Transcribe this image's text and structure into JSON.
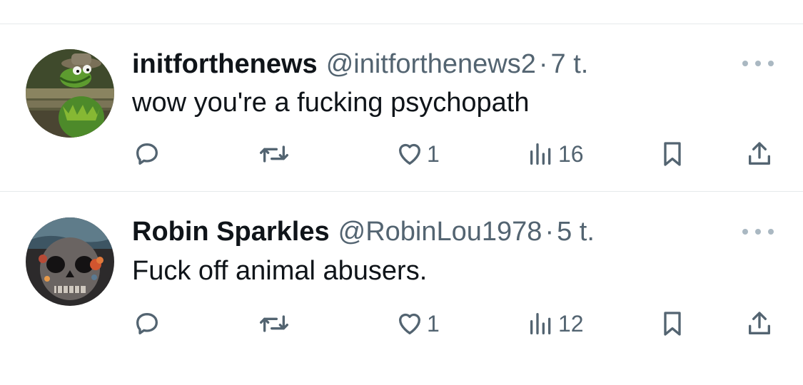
{
  "tweets": [
    {
      "display_name": "initforthenews",
      "handle": "@initforthenews2",
      "separator": "·",
      "time": "7 t.",
      "text": "wow you're a fucking psychopath",
      "likes": "1",
      "views": "16",
      "avatar": "kermit-frog-avatar"
    },
    {
      "display_name": "Robin Sparkles",
      "handle": "@RobinLou1978",
      "separator": "·",
      "time": "5 t.",
      "text": "Fuck off animal abusers.",
      "likes": "1",
      "views": "12",
      "avatar": "floral-skull-avatar"
    }
  ],
  "icons": {
    "reply": "reply-icon",
    "retweet": "retweet-icon",
    "like": "heart-icon",
    "views": "views-icon",
    "bookmark": "bookmark-icon",
    "share": "share-icon",
    "more": "more-icon"
  },
  "colors": {
    "text": "#0f1419",
    "muted": "#536471",
    "divider": "#e6e9eb",
    "more_dots": "#aab8c2"
  }
}
